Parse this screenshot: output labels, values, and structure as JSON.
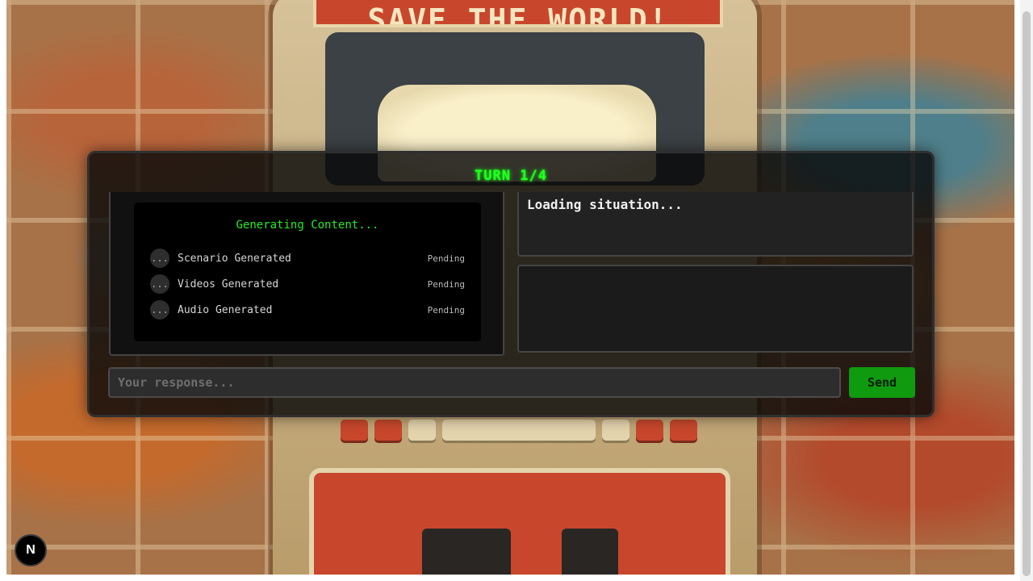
{
  "background": {
    "marquee_text": "SAVE THE WORLD!"
  },
  "game": {
    "turn_title": "TURN 1/4",
    "status": {
      "heading": "Generating Content...",
      "items": [
        {
          "indicator": "...",
          "label": "Scenario Generated",
          "state": "Pending"
        },
        {
          "indicator": "...",
          "label": "Videos Generated",
          "state": "Pending"
        },
        {
          "indicator": "...",
          "label": "Audio Generated",
          "state": "Pending"
        }
      ]
    },
    "situation_text": "Loading situation...",
    "response": {
      "placeholder": "Your response...",
      "value": ""
    },
    "send_label": "Send"
  },
  "dev_badge": {
    "label": "N"
  },
  "colors": {
    "accent_green": "#22ff22",
    "send_button": "#0f9a10",
    "panel_bg": "#111111"
  }
}
